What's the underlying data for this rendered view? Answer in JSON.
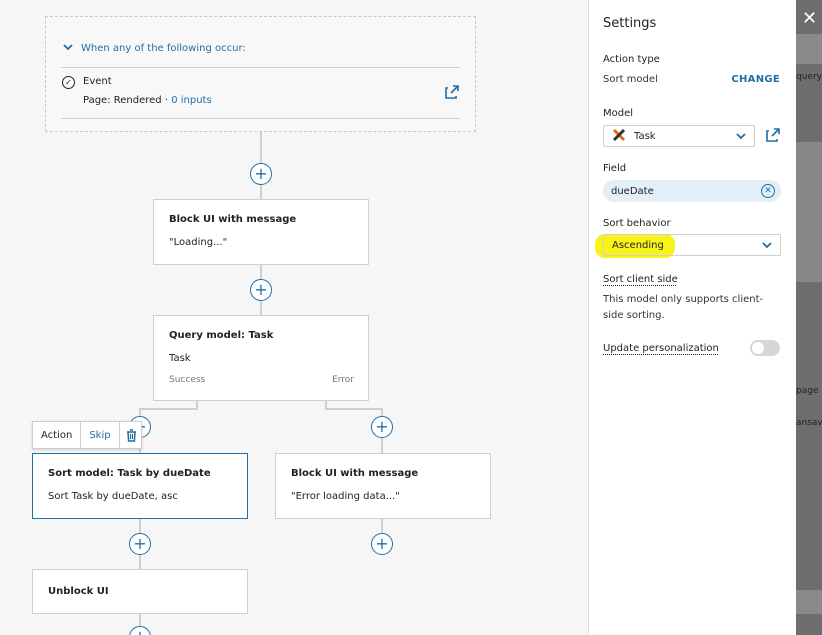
{
  "trigger": {
    "header": "When any of the following occur:",
    "event_title": "Event",
    "event_detail": "Page: Rendered · ",
    "event_link": "0 inputs"
  },
  "nodes": {
    "block_ui": {
      "title": "Block UI with message",
      "message": "\"Loading...\""
    },
    "query": {
      "title": "Query model: Task",
      "model": "Task",
      "success": "Success",
      "error": "Error"
    },
    "sort": {
      "title": "Sort model: Task by dueDate",
      "detail": "Sort Task by dueDate, asc"
    },
    "block_err": {
      "title": "Block UI with message",
      "message": "\"Error loading data...\""
    },
    "unblock": {
      "title": "Unblock UI"
    }
  },
  "action_bar": {
    "label": "Action",
    "skip": "Skip"
  },
  "settings": {
    "title": "Settings",
    "action_type_label": "Action type",
    "action_type_value": "Sort model",
    "change": "CHANGE",
    "model_label": "Model",
    "model_value": "Task",
    "field_label": "Field",
    "field_value": "dueDate",
    "sort_behavior_label": "Sort behavior",
    "sort_behavior_value": "Ascending",
    "client_side_label": "Sort client side",
    "client_side_note": "This model only supports client-side sorting.",
    "personalization_label": "Update personalization"
  },
  "background": {
    "t1": "query",
    "t2": "page",
    "t3": "ansave"
  },
  "colors": {
    "accent": "#1f6fa6",
    "highlight": "#f7f300"
  }
}
